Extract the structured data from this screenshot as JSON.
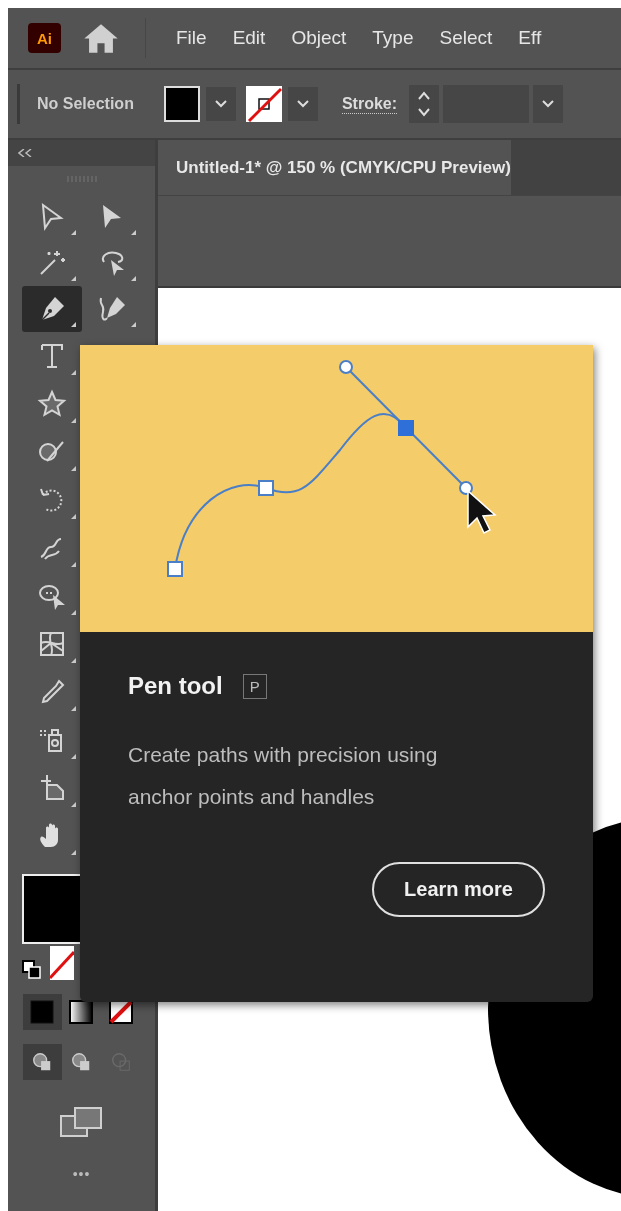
{
  "app_logo": "Ai",
  "menu": [
    "File",
    "Edit",
    "Object",
    "Type",
    "Select",
    "Eff"
  ],
  "control_bar": {
    "selection": "No Selection",
    "stroke_label": "Stroke:"
  },
  "document_tab": {
    "title": "Untitled-1* @ 150 % (CMYK/CPU Preview)",
    "selected": true
  },
  "tools": [
    {
      "selected": false
    },
    {
      "selected": false
    },
    {
      "selected": false
    },
    {
      "selected": false
    },
    {
      "selected": true
    },
    {
      "selected": false
    },
    {
      "selected": false
    },
    {
      "selected": false
    },
    {
      "selected": false
    },
    {
      "selected": false
    },
    {
      "selected": false
    },
    {
      "selected": false
    },
    {
      "selected": false
    },
    {
      "selected": false
    },
    {
      "selected": false
    },
    {
      "selected": false
    },
    {
      "selected": false
    }
  ],
  "color_modes": [
    {
      "selected": true
    },
    {
      "selected": false
    },
    {
      "selected": false
    }
  ],
  "draw_modes": [
    {
      "selected": true
    },
    {
      "selected": false
    },
    {
      "selected": false
    }
  ],
  "more_tools": "•••",
  "tooltip": {
    "title": "Pen tool",
    "shortcut": "P",
    "description": "Create paths with precision using anchor points and handles",
    "button": "Learn more"
  }
}
